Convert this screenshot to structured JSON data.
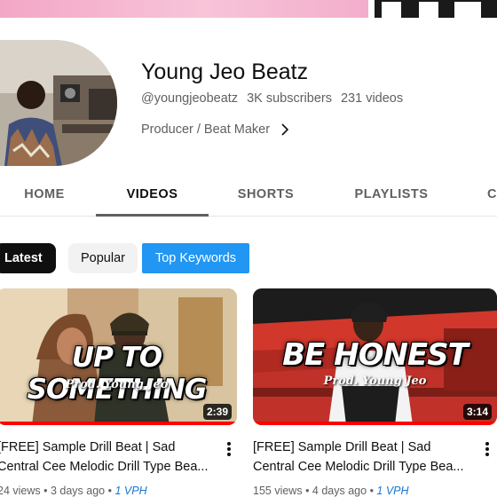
{
  "channel": {
    "name": "Young Jeo Beatz",
    "handle": "@youngjeobeatz",
    "subscribers": "3K subscribers",
    "videos": "231 videos",
    "description": "Producer / Beat Maker"
  },
  "tabs": [
    {
      "label": "HOME",
      "active": false
    },
    {
      "label": "VIDEOS",
      "active": true
    },
    {
      "label": "SHORTS",
      "active": false
    },
    {
      "label": "PLAYLISTS",
      "active": false
    },
    {
      "label": "C",
      "active": false
    }
  ],
  "chips": {
    "latest": "Latest",
    "popular": "Popular",
    "keywords": "Top Keywords"
  },
  "videos": [
    {
      "thumb_title": "UP TO SOMETHING",
      "thumb_sub": "Prod. Young Jeo",
      "duration": "2:39",
      "title_line1": "[FREE] Sample Drill Beat | Sad",
      "title_line2": "Central Cee Melodic Drill Type Bea...",
      "views": "24 views",
      "age": "3 days ago",
      "vph": "1 VPH"
    },
    {
      "thumb_title": "BE HONEST",
      "thumb_sub": "Prod. Young Jeo",
      "duration": "3:14",
      "title_line1": "[FREE] Sample Drill Beat | Sad",
      "title_line2": "Central Cee Melodic Drill Type Bea...",
      "views": "155 views",
      "age": "4 days ago",
      "vph": "1 VPH"
    }
  ],
  "colors": {
    "accent_blue": "#2196f3",
    "progress_red": "#ff0000",
    "vph_blue": "#1976d2"
  },
  "icons": {
    "description_chevron": "chevron-right-icon",
    "video_menu": "more-vert-icon"
  }
}
